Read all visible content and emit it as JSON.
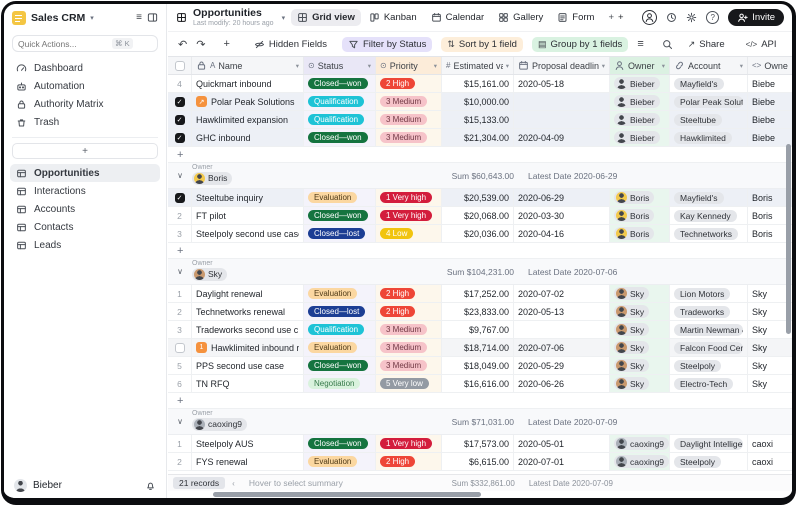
{
  "app": {
    "name": "Sales CRM"
  },
  "colors": {
    "accent_dark": "#17181b",
    "filter_tint": "#e5e1fa",
    "sort_tint": "#fdeeda",
    "group_tint": "#d9f2e1",
    "status_won": "#15743f",
    "status_qualification": "#1ec3d6",
    "status_lost": "#1c3e94",
    "status_evaluation": "#fbd7a1",
    "status_negotiation": "#d9f2dd",
    "priority_very_high": "#d31d3c",
    "priority_high": "#ee4637",
    "priority_medium": "#f6c3c9",
    "priority_low": "#f1c40f",
    "priority_very_low": "#939aa3"
  },
  "sidebar": {
    "search": {
      "placeholder": "Quick Actions...",
      "shortcut": "⌘ K"
    },
    "nav": [
      {
        "icon": "gauge-icon",
        "label": "Dashboard"
      },
      {
        "icon": "robot-icon",
        "label": "Automation"
      },
      {
        "icon": "lock-icon",
        "label": "Authority Matrix"
      },
      {
        "icon": "trash-icon",
        "label": "Trash"
      }
    ],
    "add_label": "+",
    "tables": [
      {
        "icon": "table-icon",
        "label": "Opportunities",
        "active": true
      },
      {
        "icon": "table-icon",
        "label": "Interactions",
        "active": false
      },
      {
        "icon": "table-icon",
        "label": "Accounts",
        "active": false
      },
      {
        "icon": "table-icon",
        "label": "Contacts",
        "active": false
      },
      {
        "icon": "table-icon",
        "label": "Leads",
        "active": false
      }
    ],
    "user": {
      "name": "Bieber"
    }
  },
  "header": {
    "title": "Opportunities",
    "subtitle": "Last modify: 20 hours ago",
    "views": [
      {
        "icon": "grid-icon",
        "label": "Grid view",
        "active": true
      },
      {
        "icon": "kanban-icon",
        "label": "Kanban",
        "active": false
      },
      {
        "icon": "calendar-icon",
        "label": "Calendar",
        "active": false
      },
      {
        "icon": "gallery-icon",
        "label": "Gallery",
        "active": false
      },
      {
        "icon": "form-icon",
        "label": "Form",
        "active": false
      },
      {
        "icon": "plus-icon",
        "label": "+",
        "active": false
      }
    ],
    "invite_label": "Invite"
  },
  "toolbar": {
    "hidden_fields": "Hidden Fields",
    "filter": "Filter by Status",
    "sort": "Sort by 1 field",
    "group": "Group by 1 fields",
    "share": "Share",
    "api": "API"
  },
  "table": {
    "group_label": "Owner",
    "add_label": "+",
    "owners": {
      "Bieber": "#e3e6ea",
      "Boris": "#f2c94c",
      "Sky": "#c9996e",
      "caoxing9": "#aab0b8"
    },
    "columns": [
      {
        "id": "name",
        "label": "Name",
        "icons": [
          "lock-icon",
          "text-field-icon"
        ],
        "tint": ""
      },
      {
        "id": "status",
        "label": "Status",
        "icons": [
          "select-icon"
        ],
        "tint": "filter"
      },
      {
        "id": "pri",
        "label": "Priority",
        "icons": [
          "select-icon"
        ],
        "tint": "sort"
      },
      {
        "id": "val",
        "label": "Estimated value",
        "icons": [
          "number-icon"
        ],
        "tint": ""
      },
      {
        "id": "date",
        "label": "Proposal deadline",
        "icons": [
          "calendar-icon"
        ],
        "tint": ""
      },
      {
        "id": "owner",
        "label": "Owner",
        "icons": [
          "user-icon"
        ],
        "tint": "group"
      },
      {
        "id": "acct",
        "label": "Account",
        "icons": [
          "link-icon"
        ],
        "tint": ""
      },
      {
        "id": "extra",
        "label": "Owner",
        "icons": [
          "code-icon"
        ],
        "tint": ""
      }
    ],
    "items": [
      {
        "type": "row",
        "num": "4",
        "name": "Quickmart inbound",
        "status": "Closed—won",
        "sk": "won",
        "pri": "2 High",
        "pk": "high",
        "value": "$15,161.00",
        "date": "2020-05-18",
        "owner": "Bieber",
        "account": "Mayfield's",
        "extra": "Biebe"
      },
      {
        "type": "row",
        "checked": true,
        "badge": "↗",
        "name": "Polar Peak Solutions",
        "status": "Qualification",
        "sk": "qual",
        "pri": "3 Medium",
        "pk": "med",
        "value": "$10,000.00",
        "date": "",
        "owner": "Bieber",
        "account": "Polar Peak Solutions",
        "extra": "Biebe"
      },
      {
        "type": "row",
        "checked": true,
        "name": "Hawklimited expansion",
        "status": "Qualification",
        "sk": "qual",
        "pri": "3 Medium",
        "pk": "med",
        "value": "$15,133.00",
        "date": "",
        "owner": "Bieber",
        "account": "Steeltube",
        "extra": "Biebe"
      },
      {
        "type": "row",
        "checked": true,
        "name": "GHC inbound",
        "status": "Closed—won",
        "sk": "won",
        "pri": "3 Medium",
        "pk": "med",
        "value": "$21,304.00",
        "date": "2020-04-09",
        "owner": "Bieber",
        "account": "Hawklimited",
        "extra": "Biebe"
      },
      {
        "type": "add"
      },
      {
        "type": "group",
        "owner": "Boris",
        "sum": "Sum $60,643.00",
        "latest": "Latest Date 2020-06-29"
      },
      {
        "type": "row",
        "checked": true,
        "name": "Steeltube inquiry",
        "status": "Evaluation",
        "sk": "eval",
        "pri": "1 Very high",
        "pk": "vhigh",
        "value": "$20,539.00",
        "date": "2020-06-29",
        "owner": "Boris",
        "account": "Mayfield's",
        "extra": "Boris"
      },
      {
        "type": "row",
        "num": "2",
        "name": "FT pilot",
        "status": "Closed—won",
        "sk": "won",
        "pri": "1 Very high",
        "pk": "vhigh",
        "value": "$20,068.00",
        "date": "2020-03-30",
        "owner": "Boris",
        "account": "Kay Kennedy",
        "extra": "Boris"
      },
      {
        "type": "row",
        "num": "3",
        "name": "Steelpoly second use case",
        "status": "Closed—lost",
        "sk": "lost",
        "pri": "4 Low",
        "pk": "low",
        "value": "$20,036.00",
        "date": "2020-04-16",
        "owner": "Boris",
        "account": "Technetworks",
        "extra": "Boris"
      },
      {
        "type": "add"
      },
      {
        "type": "group",
        "owner": "Sky",
        "sum": "Sum $104,231.00",
        "latest": "Latest Date 2020-07-06"
      },
      {
        "type": "row",
        "num": "1",
        "name": "Daylight renewal",
        "status": "Evaluation",
        "sk": "eval",
        "pri": "2 High",
        "pk": "high",
        "value": "$17,252.00",
        "date": "2020-07-02",
        "owner": "Sky",
        "account": "Lion Motors",
        "extra": "Sky"
      },
      {
        "type": "row",
        "num": "2",
        "name": "Technetworks renewal",
        "status": "Closed—lost",
        "sk": "lost",
        "pri": "2 High",
        "pk": "high",
        "value": "$23,833.00",
        "date": "2020-05-13",
        "owner": "Sky",
        "account": "Tradeworks",
        "extra": "Sky"
      },
      {
        "type": "row",
        "num": "3",
        "name": "Tradeworks second use c...",
        "status": "Qualification",
        "sk": "qual",
        "pri": "3 Medium",
        "pk": "med",
        "value": "$9,767.00",
        "date": "",
        "owner": "Sky",
        "account": "Martin Newman & S...",
        "extra": "Sky"
      },
      {
        "type": "row",
        "hover": true,
        "badge": "1",
        "name": "Hawklimited inbound req",
        "status": "Evaluation",
        "sk": "eval",
        "pri": "3 Medium",
        "pk": "med",
        "value": "$18,714.00",
        "date": "2020-07-06",
        "owner": "Sky",
        "account": "Falcon Food Centers",
        "extra": "Sky"
      },
      {
        "type": "row",
        "num": "5",
        "name": "PPS second use case",
        "status": "Closed—won",
        "sk": "won",
        "pri": "3 Medium",
        "pk": "med",
        "value": "$18,049.00",
        "date": "2020-05-29",
        "owner": "Sky",
        "account": "Steelpoly",
        "extra": "Sky"
      },
      {
        "type": "row",
        "num": "6",
        "name": "TN RFQ",
        "status": "Negotiation",
        "sk": "nego",
        "pri": "5 Very low",
        "pk": "vlow",
        "value": "$16,616.00",
        "date": "2020-06-26",
        "owner": "Sky",
        "account": "Electro-Tech",
        "extra": "Sky"
      },
      {
        "type": "add"
      },
      {
        "type": "group",
        "owner": "caoxing9",
        "sum": "Sum $71,031.00",
        "latest": "Latest Date 2020-07-09"
      },
      {
        "type": "row",
        "num": "1",
        "name": "Steelpoly AUS",
        "status": "Closed—won",
        "sk": "won",
        "pri": "1 Very high",
        "pk": "vhigh",
        "value": "$17,573.00",
        "date": "2020-05-01",
        "owner": "caoxing9",
        "account": "Daylight Intelligence",
        "extra": "caoxi"
      },
      {
        "type": "row",
        "num": "2",
        "name": "FYS renewal",
        "status": "Evaluation",
        "sk": "eval",
        "pri": "2 High",
        "pk": "high",
        "value": "$6,615.00",
        "date": "2020-07-01",
        "owner": "caoxing9",
        "account": "Steelpoly",
        "extra": "caoxi"
      }
    ]
  },
  "footer": {
    "records": "21 records",
    "collapse_icon": "‹",
    "hint": "Hover to select summary",
    "sum": "Sum $332,861.00",
    "latest": "Latest Date 2020-07-09"
  }
}
